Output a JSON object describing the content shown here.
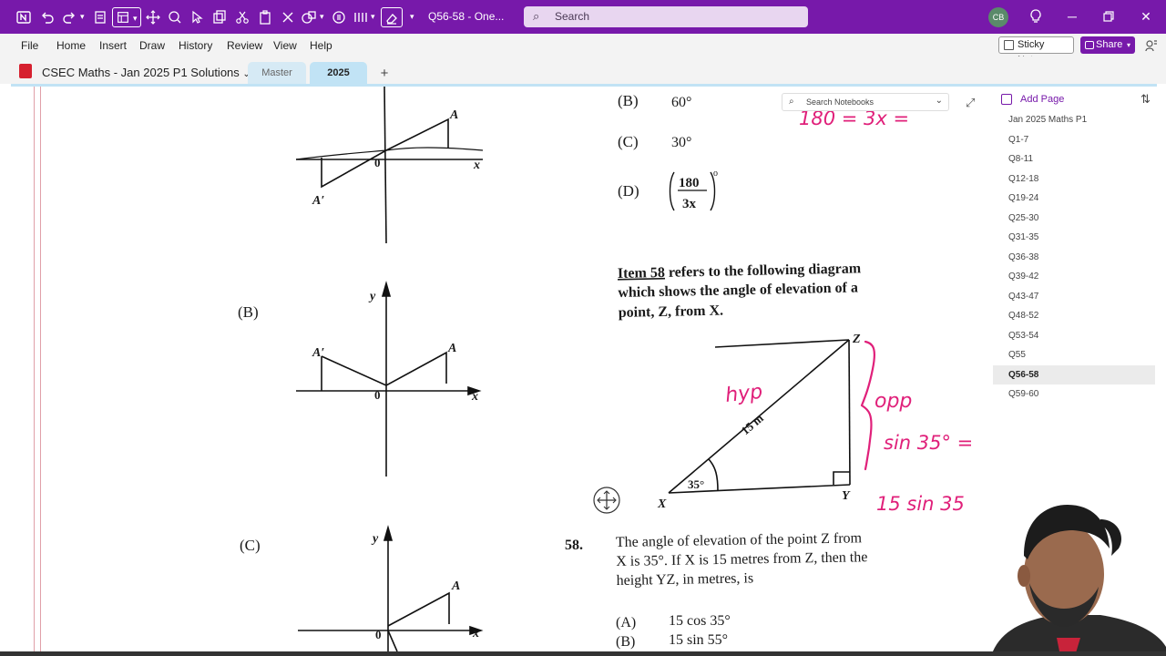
{
  "titlebar": {
    "doc_title": "Q56-58  -  One...",
    "search_placeholder": "Search",
    "avatar_initials": "CB",
    "accent": "#7719aa"
  },
  "menu": {
    "items": [
      "File",
      "Home",
      "Insert",
      "Draw",
      "History",
      "Review",
      "View",
      "Help"
    ],
    "sticky_notes": "Sticky Notes",
    "share": "Share"
  },
  "notebook": {
    "title": "CSEC Maths - Jan 2025 P1 Solutions",
    "tabs": [
      {
        "label": "Master"
      },
      {
        "label": "2025"
      },
      {
        "label": "+"
      }
    ]
  },
  "right_pane": {
    "search_placeholder": "Search Notebooks",
    "add_page": "Add Page",
    "pages": [
      "Jan 2025 Maths P1",
      "Q1-7",
      "Q8-11",
      "Q12-18",
      "Q19-24",
      "Q25-30",
      "Q31-35",
      "Q36-38",
      "Q39-42",
      "Q43-47",
      "Q48-52",
      "Q53-54",
      "Q55",
      "Q56-58",
      "Q59-60"
    ],
    "active_page": "Q56-58"
  },
  "content": {
    "options_top": [
      {
        "letter": "(B)",
        "text": "60°"
      },
      {
        "letter": "(C)",
        "text": "30°"
      },
      {
        "letter": "(D)",
        "text": ""
      }
    ],
    "d_fraction": {
      "num": "180",
      "den": "3x",
      "power": "o"
    },
    "graph_labels": {
      "axis_x": "x",
      "axis_y": "y",
      "origin": "0",
      "point_a": "A",
      "point_a_prime": "A′",
      "option_b": "(B)",
      "option_c": "(C)"
    },
    "item_ref": {
      "item_label": "Item 58",
      "line1": " refers to the following diagram",
      "line2": "which shows the angle of elevation of a",
      "line3": "point, Z, from X."
    },
    "triangle": {
      "vertex_x": "X",
      "vertex_y": "Y",
      "vertex_z": "Z",
      "hypotenuse": "15 m",
      "angle": "35°"
    },
    "question": {
      "number": "58.",
      "line1": "The angle of elevation of the point Z from",
      "line2": "X is 35°.  If X is 15 metres from Z, then the",
      "line3": "height YZ, in metres, is",
      "answers": [
        {
          "letter": "(A)",
          "text": "15 cos 35°"
        },
        {
          "letter": "(B)",
          "text": "15 sin 55°"
        }
      ]
    },
    "ink_notes": {
      "hyp": "hyp",
      "opp": "opp",
      "sin_note": "sin 35° =",
      "calc": "15 sin 35",
      "top_note": "180 = 3x ="
    }
  }
}
